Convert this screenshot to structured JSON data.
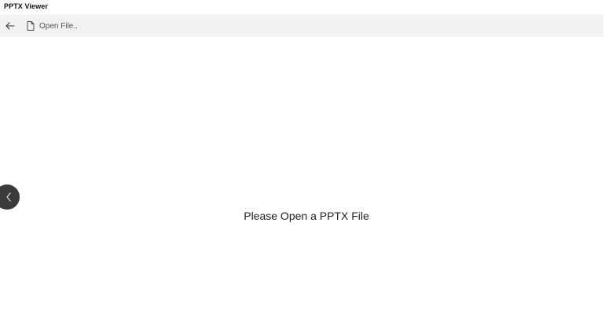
{
  "window": {
    "title": "PPTX Viewer"
  },
  "toolbar": {
    "back_icon": "arrow-left-icon",
    "open_file_icon": "document-icon",
    "open_file_label": "Open File.."
  },
  "viewer": {
    "prev_slide_icon": "chevron-left-icon",
    "empty_message": "Please Open a PPTX File"
  }
}
